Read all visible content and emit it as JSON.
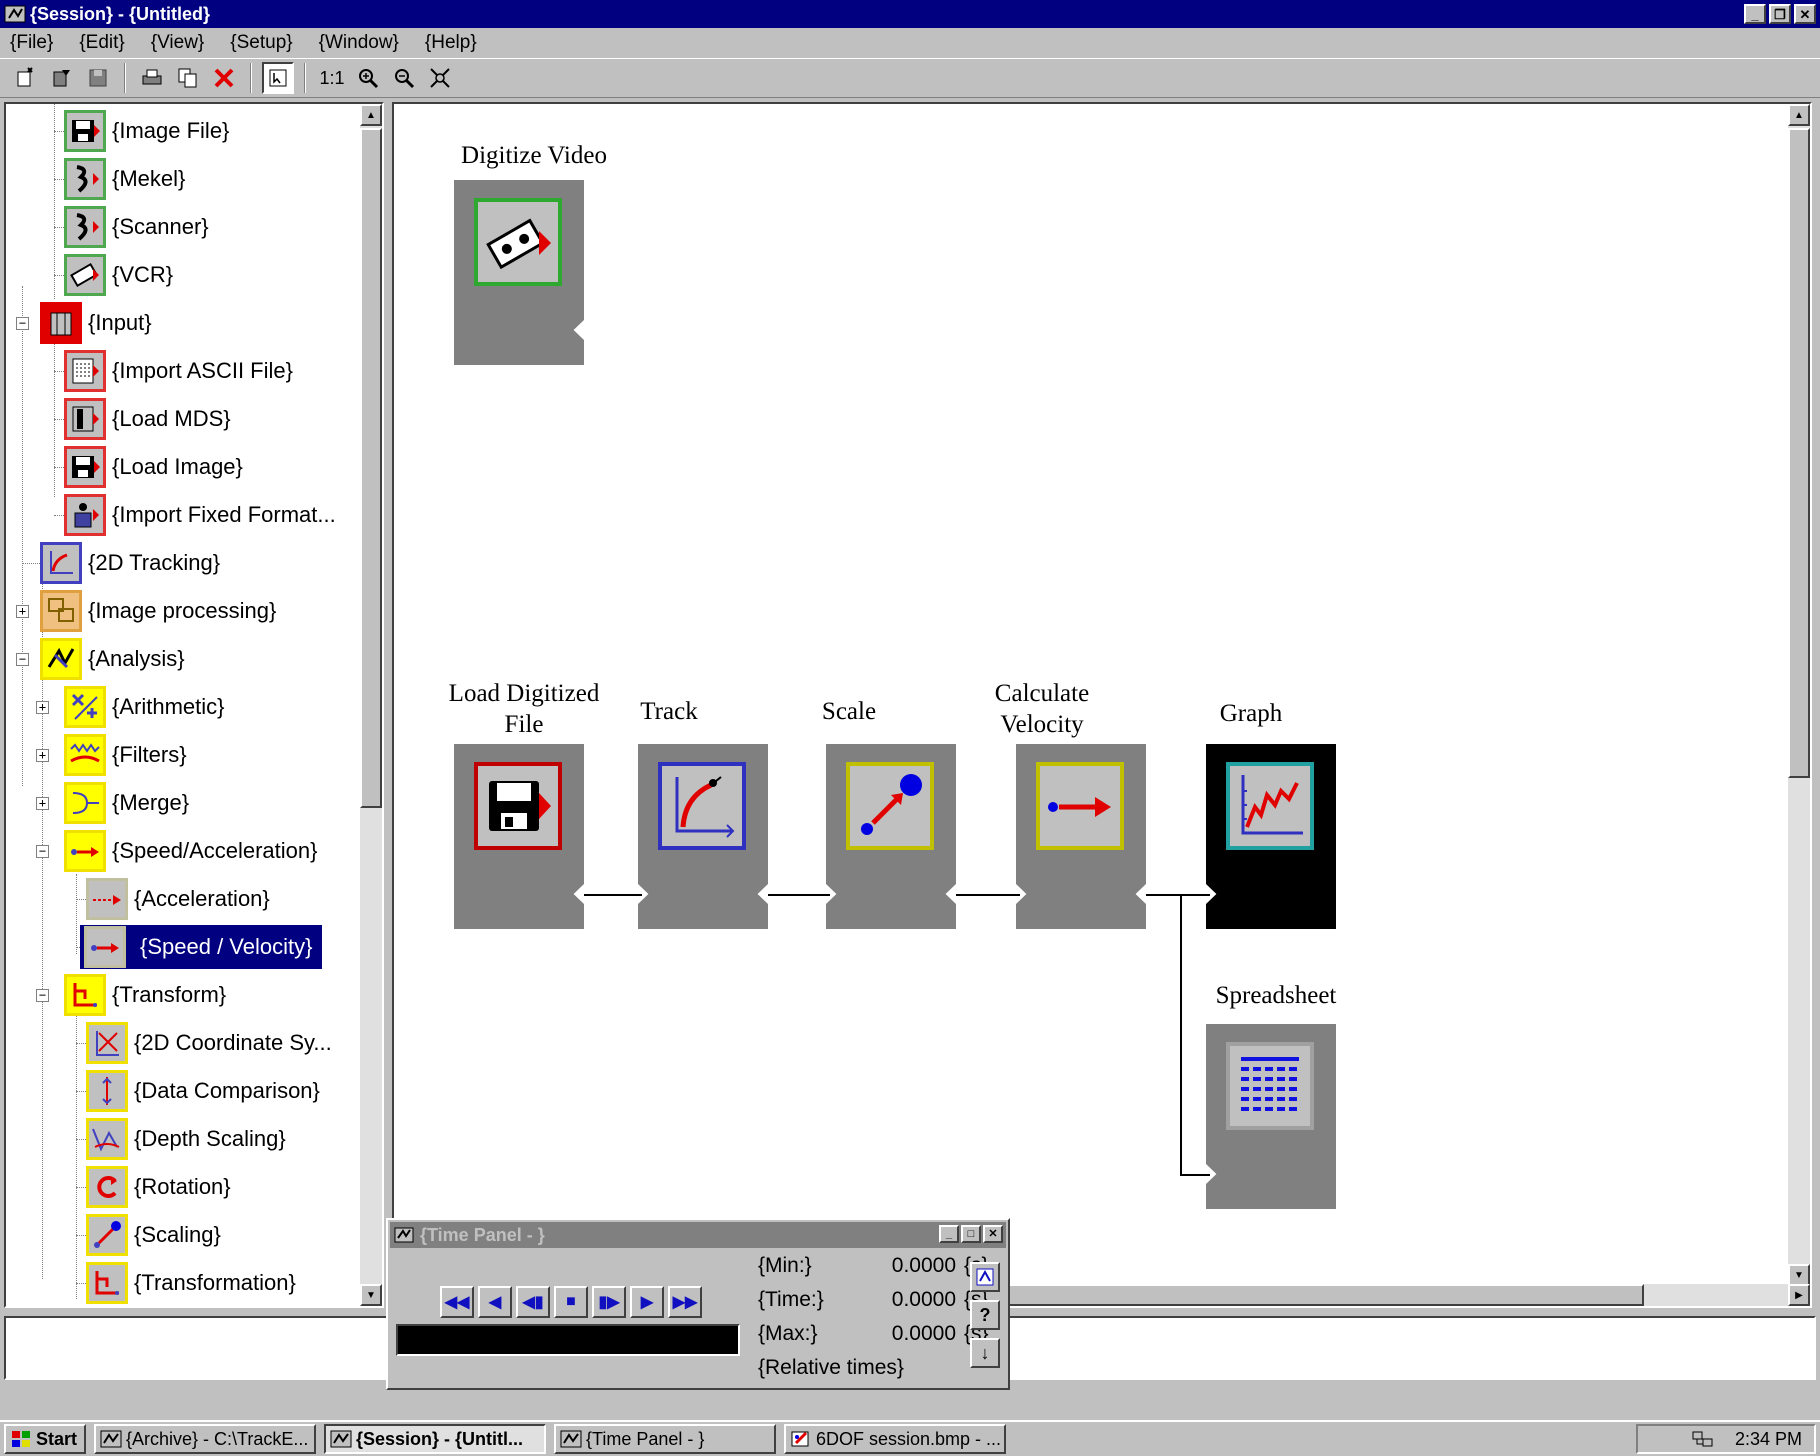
{
  "window": {
    "title": "{Session} - {Untitled}"
  },
  "menu": [
    "{File}",
    "{Edit}",
    "{View}",
    "{Setup}",
    "{Window}",
    "{Help}"
  ],
  "toolbar": {
    "zoom_1to1": "1:1"
  },
  "tree": {
    "items": [
      {
        "label": "{Image File}"
      },
      {
        "label": "{Mekel}"
      },
      {
        "label": "{Scanner}"
      },
      {
        "label": "{VCR}"
      },
      {
        "label": "{Input}"
      },
      {
        "label": "{Import ASCII File}"
      },
      {
        "label": "{Load MDS}"
      },
      {
        "label": "{Load Image}"
      },
      {
        "label": "{Import Fixed Format..."
      },
      {
        "label": "{2D Tracking}"
      },
      {
        "label": "{Image processing}"
      },
      {
        "label": "{Analysis}"
      },
      {
        "label": "{Arithmetic}"
      },
      {
        "label": "{Filters}"
      },
      {
        "label": "{Merge}"
      },
      {
        "label": "{Speed/Acceleration}"
      },
      {
        "label": "{Acceleration}"
      },
      {
        "label": "{Speed / Velocity}"
      },
      {
        "label": "{Transform}"
      },
      {
        "label": "{2D Coordinate Sy..."
      },
      {
        "label": "{Data Comparison}"
      },
      {
        "label": "{Depth Scaling}"
      },
      {
        "label": "{Rotation}"
      },
      {
        "label": "{Scaling}"
      },
      {
        "label": "{Transformation}"
      }
    ]
  },
  "nodes": {
    "digitize": {
      "label": "Digitize Video"
    },
    "load": {
      "label_line1": "Load Digitized",
      "label_line2": "File"
    },
    "track": {
      "label": "Track"
    },
    "scale": {
      "label": "Scale"
    },
    "calc": {
      "label_line1": "Calculate",
      "label_line2": "Velocity"
    },
    "graph": {
      "label": "Graph"
    },
    "spreadsheet": {
      "label": "Spreadsheet"
    }
  },
  "time_panel": {
    "title": "{Time Panel - }",
    "min_label": "{Min:}",
    "min_value": "0.0000",
    "min_unit": "{s}",
    "time_label": "{Time:}",
    "time_value": "0.0000",
    "time_unit": "{s}",
    "max_label": "{Max:}",
    "max_value": "0.0000",
    "max_unit": "{s}",
    "relative": "{Relative times}"
  },
  "taskbar": {
    "start": "Start",
    "tasks": [
      {
        "label": "{Archive} - C:\\TrackE..."
      },
      {
        "label": "{Session} - {Untitl..."
      },
      {
        "label": "{Time Panel - }"
      },
      {
        "label": "6DOF session.bmp - ..."
      }
    ],
    "clock": "2:34 PM"
  },
  "colors": {
    "titlebar": "#000080",
    "node_gray": "#808080",
    "selection": "#000080",
    "green_icon_border": "#4fa84f",
    "red_icon_border": "#e03030",
    "yellow_icon": "#ffff00"
  }
}
